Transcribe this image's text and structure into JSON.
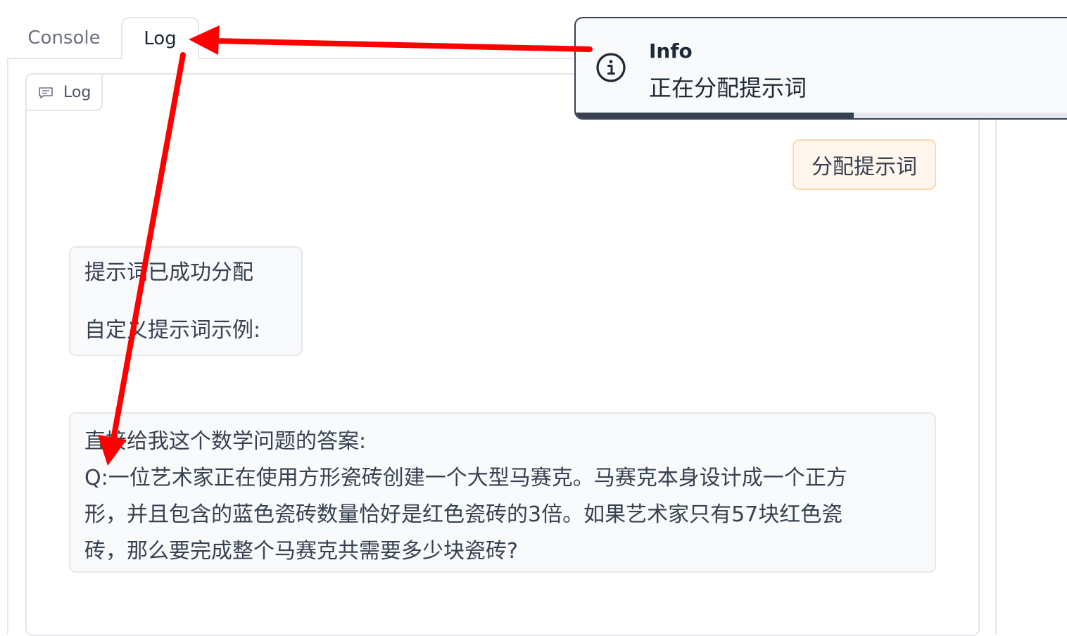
{
  "tabs": {
    "console_label": "Console",
    "log_label": "Log"
  },
  "chat": {
    "panel_label": "Log",
    "messages": [
      {
        "role": "user",
        "text": "分配提示词"
      },
      {
        "role": "bot",
        "lines": [
          "提示词已成功分配",
          "自定义提示词示例:"
        ]
      },
      {
        "role": "bot",
        "lines": [
          "直接给我这个数学问题的答案:",
          "Q:一位艺术家正在使用方形瓷砖创建一个大型马赛克。马赛克本身设计成一个正方",
          "形，并且包含的蓝色瓷砖数量恰好是红色瓷砖的3倍。如果艺术家只有57块红色瓷",
          "砖，那么要完成整个马赛克共需要多少块瓷砖?"
        ]
      }
    ]
  },
  "toast": {
    "title": "Info",
    "message": "正在分配提示词",
    "icon": "info-icon",
    "progress": 0.55
  },
  "annotation": {
    "color": "#ff0000",
    "icons": [
      "arrow-to-log-tab",
      "arrow-to-message"
    ]
  },
  "colors": {
    "user_bubble_bg": "#fff7ed",
    "user_bubble_border": "#fed7aa",
    "bot_bubble_bg": "#f9fafb",
    "border": "#e5e7eb",
    "toast_accent": "#374151"
  }
}
